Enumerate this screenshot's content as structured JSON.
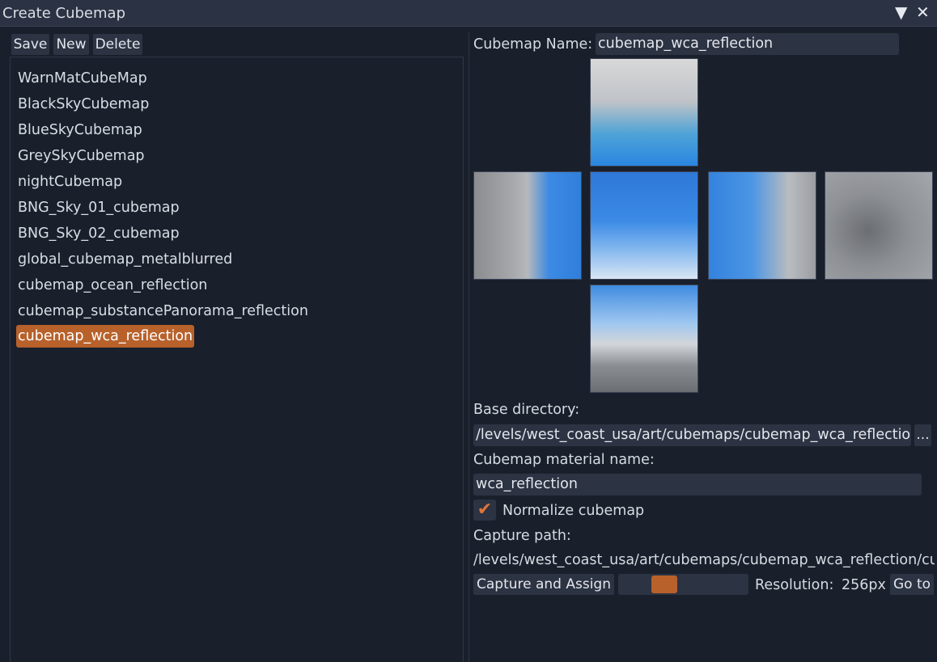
{
  "window": {
    "title": "Create Cubemap",
    "collapse_icon": "triangle-down-icon",
    "close_icon": "close-icon",
    "collapse_glyph": "▼",
    "close_glyph": "✕"
  },
  "toolbar": {
    "save_label": "Save",
    "new_label": "New",
    "delete_label": "Delete"
  },
  "cubemap_list": {
    "items": [
      {
        "label": "WarnMatCubeMap"
      },
      {
        "label": "BlackSkyCubemap"
      },
      {
        "label": "BlueSkyCubemap"
      },
      {
        "label": "GreySkyCubemap"
      },
      {
        "label": "nightCubemap"
      },
      {
        "label": "BNG_Sky_01_cubemap"
      },
      {
        "label": "BNG_Sky_02_cubemap"
      },
      {
        "label": "global_cubemap_metalblurred"
      },
      {
        "label": "cubemap_ocean_reflection"
      },
      {
        "label": "cubemap_substancePanorama_reflection"
      },
      {
        "label": "cubemap_wca_reflection",
        "selected": true
      }
    ],
    "selected_color": "#b8612b"
  },
  "editor": {
    "name_label": "Cubemap Name:",
    "name_value": "cubemap_wca_reflection",
    "base_directory_label": "Base directory:",
    "base_directory_value": "/levels/west_coast_usa/art/cubemaps/cubemap_wca_reflection",
    "browse_label": "...",
    "material_label": "Cubemap material name:",
    "material_value": "wca_reflection",
    "normalize_label": "Normalize cubemap",
    "normalize_checked": true,
    "check_glyph": "✔",
    "capture_path_label": "Capture path:",
    "capture_path_value": "/levels/west_coast_usa/art/cubemaps/cubemap_wca_reflection/cu",
    "capture_button_label": "Capture and Assign",
    "resolution_slider_level": 0.31,
    "resolution_label": "Resolution:",
    "resolution_value": "256px",
    "goto_label": "Go to"
  },
  "cube_faces": [
    "top",
    "left",
    "front",
    "right",
    "back",
    "bottom"
  ],
  "colors": {
    "background": "#1a202b",
    "panel": "#2c3342",
    "accent": "#b8612b",
    "check": "#e0743a"
  }
}
